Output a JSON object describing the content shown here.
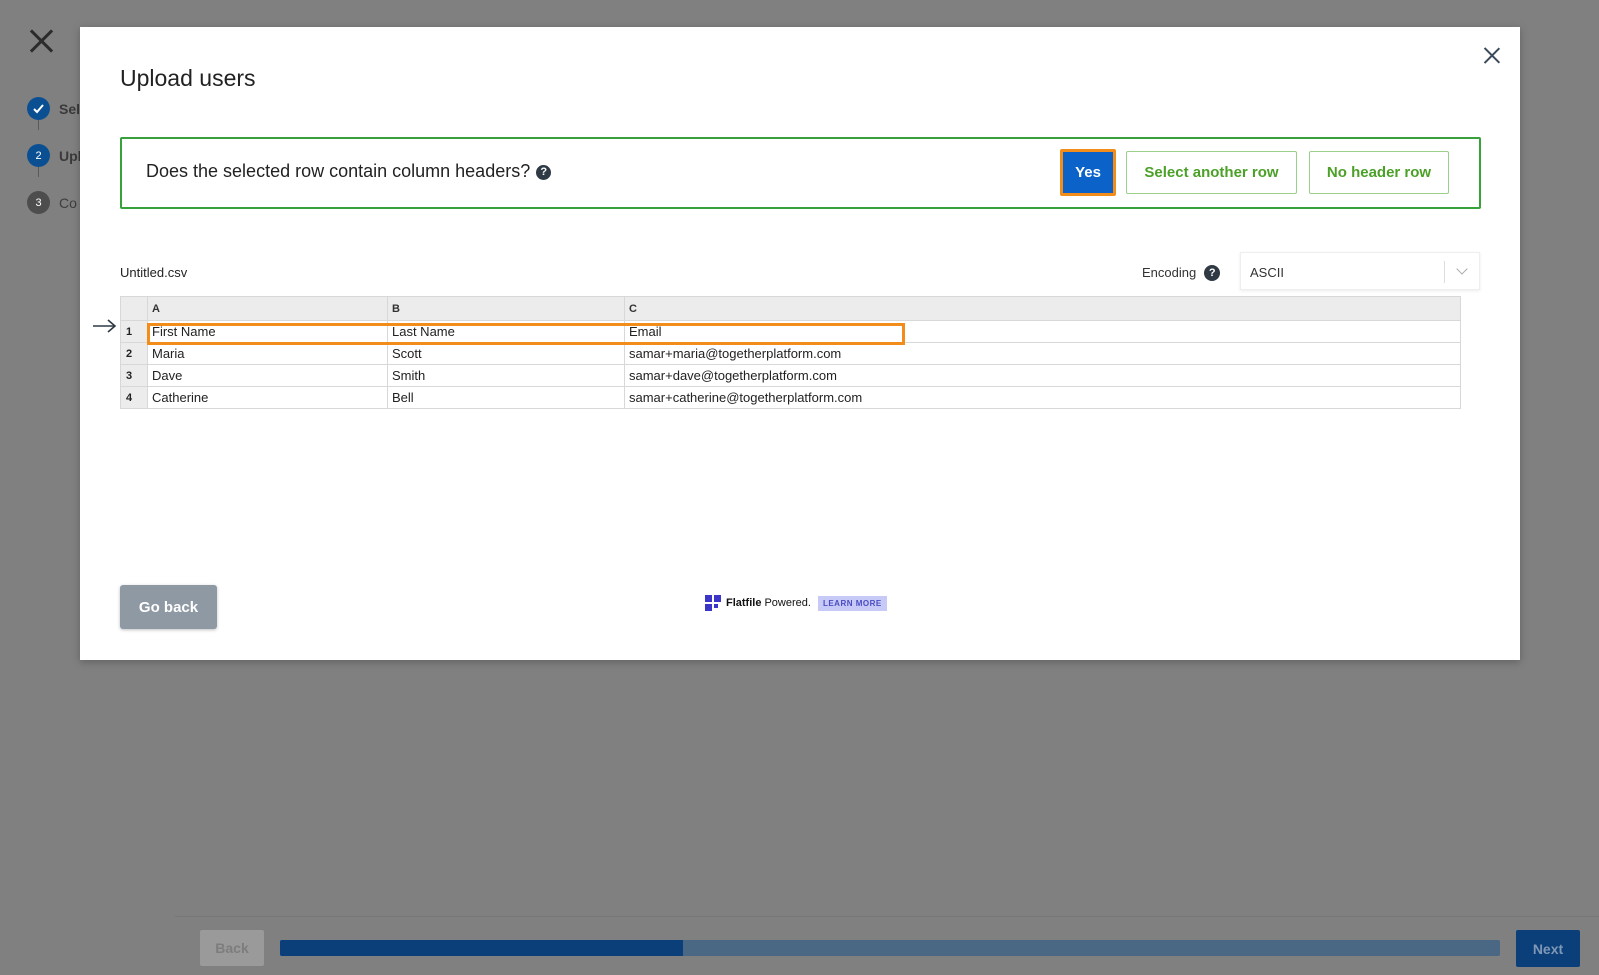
{
  "background": {
    "steps": [
      {
        "number": "",
        "label": "Sel",
        "state": "done",
        "color": "#0b4f93"
      },
      {
        "number": "2",
        "label": "Upl",
        "state": "active",
        "color": "#0b4f93"
      },
      {
        "number": "3",
        "label": "Co",
        "state": "pending",
        "color": "#4d4d4d"
      }
    ],
    "footer": {
      "back_label": "Back",
      "next_label": "Next",
      "progress": 0.33
    }
  },
  "modal": {
    "title": "Upload users",
    "question": "Does the selected row contain column headers?",
    "help_glyph": "?",
    "buttons": {
      "yes": "Yes",
      "select_another": "Select another row",
      "no_header": "No header row"
    },
    "file_name": "Untitled.csv",
    "encoding": {
      "label": "Encoding",
      "value": "ASCII"
    },
    "table": {
      "columns": [
        "A",
        "B",
        "C"
      ],
      "rows": [
        {
          "num": "1",
          "cells": [
            "First Name",
            "Last Name",
            "Email"
          ]
        },
        {
          "num": "2",
          "cells": [
            "Maria",
            "Scott",
            "samar+maria@togetherplatform.com"
          ]
        },
        {
          "num": "3",
          "cells": [
            "Dave",
            "Smith",
            "samar+dave@togetherplatform.com"
          ]
        },
        {
          "num": "4",
          "cells": [
            "Catherine",
            "Bell",
            "samar+catherine@togetherplatform.com"
          ]
        }
      ],
      "selected_row": 1
    },
    "go_back_label": "Go back",
    "powered": {
      "brand": "Flatfile",
      "text": "Powered.",
      "learn_more": "LEARN MORE"
    }
  },
  "colors": {
    "accent": "#0b63c9",
    "highlight": "#f28d1b",
    "success_border": "#38a13b",
    "success_text": "#4ba128"
  }
}
